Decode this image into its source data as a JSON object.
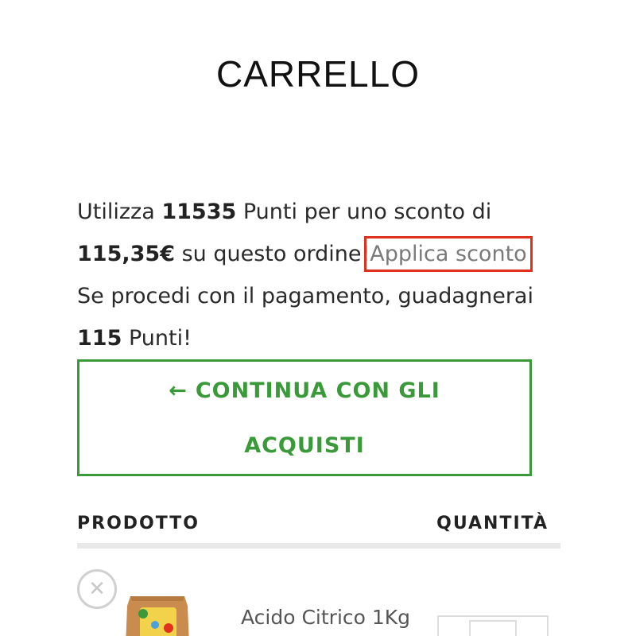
{
  "page": {
    "title": "CARRELLO"
  },
  "points_notice": {
    "use_prefix": "Utilizza",
    "points_amount": "11535",
    "use_mid": "Punti per uno sconto di",
    "discount_amount": "115,35€",
    "order_suffix": "su questo ordine!",
    "apply_link_label": "Applica sconto",
    "earn_line": "Se procedi con il pagamento, guadagnerai",
    "earn_points": "115",
    "earn_suffix": "Punti!"
  },
  "continue_button": {
    "arrow": "←",
    "line1": "CONTINUA CON GLI",
    "line2": "ACQUISTI"
  },
  "cart_table": {
    "columns": [
      "PRODOTTO",
      "QUANTITÀ"
    ],
    "rows": [
      {
        "product_name": "Acido Citrico 1Kg",
        "remove_icon": "close-icon",
        "thumbnail_icon": "product-bag-icon"
      }
    ]
  },
  "colors": {
    "accent_green": "#3a9a3a",
    "highlight_red": "#e0301e",
    "link_gray": "#7a7a7a"
  }
}
